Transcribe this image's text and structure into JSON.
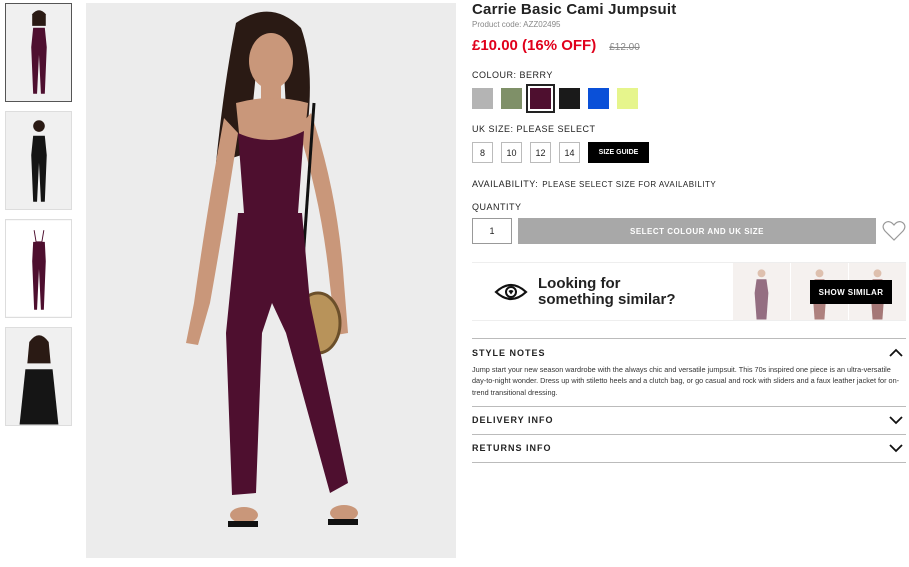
{
  "product": {
    "title": "Carrie Basic Cami Jumpsuit",
    "code": "Product code: AZZ02495",
    "price": "£10.00 (16% OFF)",
    "old_price": "£12.00"
  },
  "colour": {
    "label": "COLOUR: ",
    "value": "BERRY",
    "swatches": [
      {
        "name": "grey",
        "color": "#b4b4b4"
      },
      {
        "name": "khaki",
        "color": "#7f9068"
      },
      {
        "name": "berry",
        "color": "#4e0f2f"
      },
      {
        "name": "black",
        "color": "#1a1a1a"
      },
      {
        "name": "blue",
        "color": "#0a50d8"
      },
      {
        "name": "lime",
        "color": "#e6f58c"
      }
    ]
  },
  "size": {
    "label": "UK SIZE: ",
    "value": "PLEASE SELECT",
    "options": [
      "8",
      "10",
      "12",
      "14"
    ],
    "guide_label": "SIZE GUIDE"
  },
  "availability": {
    "label": "AVAILABILITY:",
    "value": "PLEASE SELECT SIZE FOR AVAILABILITY"
  },
  "quantity": {
    "label": "QUANTITY",
    "value": "1"
  },
  "add_button": "SELECT COLOUR AND UK SIZE",
  "similar": {
    "line1": "Looking for",
    "line2": "something similar?",
    "button": "SHOW SIMILAR"
  },
  "accordion": {
    "style_notes": {
      "title": "STYLE NOTES",
      "body": "Jump start your new season wardrobe with the always chic and versatile jumpsuit. This 70s inspired one piece is an ultra-versatile day-to-night wonder. Dress up with stiletto heels and a clutch bag, or go casual and rock with sliders and a faux leather jacket for on-trend transitional dressing."
    },
    "delivery": {
      "title": "DELIVERY INFO"
    },
    "returns": {
      "title": "RETURNS INFO"
    }
  },
  "colors": {
    "price_red": "#e0001b",
    "berry": "#4e0f2f",
    "button_grey": "#a8a8a8"
  }
}
